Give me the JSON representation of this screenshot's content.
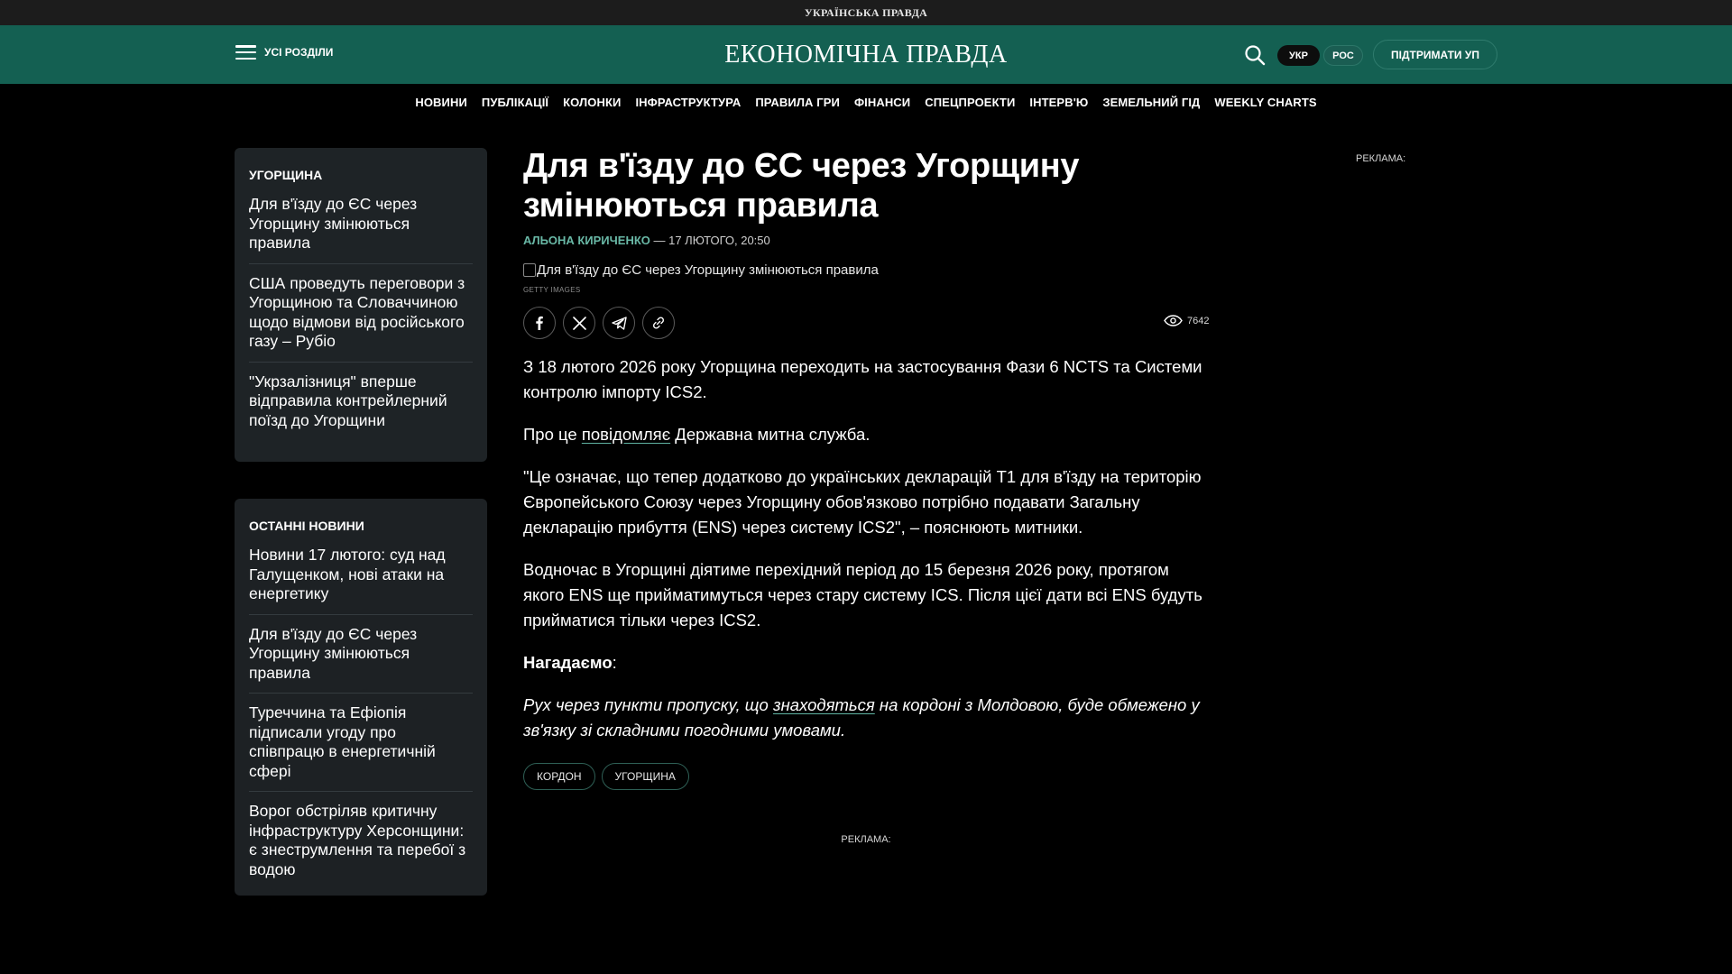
{
  "topbar": {
    "logo": "УКРАЇНСЬКА ПРАВДА"
  },
  "header": {
    "menu_label": "УСІ РОЗДІЛИ",
    "logo": "ЕКОНОМІЧНА ПРАВДА",
    "lang_active": "УКР",
    "lang_inactive": "РОС",
    "support": "ПІДТРИМАТИ УП",
    "search_icon": "search-icon",
    "menu_icon": "hamburger-icon"
  },
  "nav": {
    "items": [
      "НОВИНИ",
      "ПУБЛІКАЦІЇ",
      "КОЛОНКИ",
      "ІНФРАСТРУКТУРА",
      "ПРАВИЛА ГРИ",
      "ФІНАНСИ",
      "СПЕЦПРОЕКТИ",
      "ІНТЕРВ'Ю",
      "ЗЕМЕЛЬНИЙ ГІД",
      "WEEKLY CHARTS"
    ]
  },
  "sidebar_topic": {
    "title": "УГОРЩИНА",
    "items": [
      "Для в'їзду до ЄС через Угорщину змінюються правила",
      "США проведуть переговори з Угорщиною та Словаччиною щодо відмови від російського газу – Рубіо",
      "\"Укрзалізниця\" вперше відправила контрейлерний поїзд до Угорщини"
    ]
  },
  "sidebar_latest": {
    "title": "ОСТАННІ НОВИНИ",
    "items": [
      "Новини 17 лютого: суд над Галущенком, нові атаки на енергетику",
      "Для в'їзду до ЄС через Угорщину змінюються правила",
      "Туреччина та Ефіопія підписали угоду про співпрацю в енергетичній сфері",
      "Ворог обстріляв критичну інфраструктуру Херсонщини: є знеструмлення та перебої з водою"
    ]
  },
  "article": {
    "title": "Для в'їзду до ЄС через Угорщину змінюються правила",
    "author": "АЛЬОНА КИРИЧЕНКО",
    "date": " — 17 ЛЮТОГО, 20:50",
    "image_alt": "Для в'їзду до ЄС через Угорщину змінюються правила",
    "image_credit": "GETTY IMAGES",
    "views": "7642",
    "share_icons": [
      "facebook-icon",
      "x-icon",
      "telegram-icon",
      "link-icon"
    ],
    "p1": "З 18 лютого 2026 року Угорщина переходить на застосування Фази 6 NCTS та Системи контролю імпорту ICS2.",
    "p2_before": "Про це ",
    "p2_link": "повідомляє",
    "p2_after": " Державна митна служба.",
    "p3": "\"Це означає, що тепер додатково до українських декларацій Т1 для в'їзду на територію Європейського Союзу через Угорщину обов'язково потрібно подавати Загальну декларацію прибуття (ENS) через систему ICS2\", – пояснюють митники.",
    "p4": "Водночас в Угорщині діятиме перехідний період до 15 березня 2026 року, протягом якого ENS ще прийматимуться через стару систему ICS. Після цієї дати всі ENS будуть прийматися тільки через ICS2.",
    "reminder": "Нагадаємо",
    "reminder_colon": ":",
    "p5_before": "Рух через пункти пропуску, що ",
    "p5_link": "знаходяться",
    "p5_after": " на кордоні з Молдовою, буде обмежено у зв'язку зі складними погодними умовами.",
    "tags": [
      "КОРДОН",
      "УГОРЩИНА"
    ]
  },
  "ads": {
    "right": "РЕКЛАМА:",
    "bottom": "РЕКЛАМА:"
  },
  "colors": {
    "header_bg": "#146052",
    "accent": "#69b8a6",
    "page_bg": "#000000",
    "card_bg": "#1e2326"
  }
}
